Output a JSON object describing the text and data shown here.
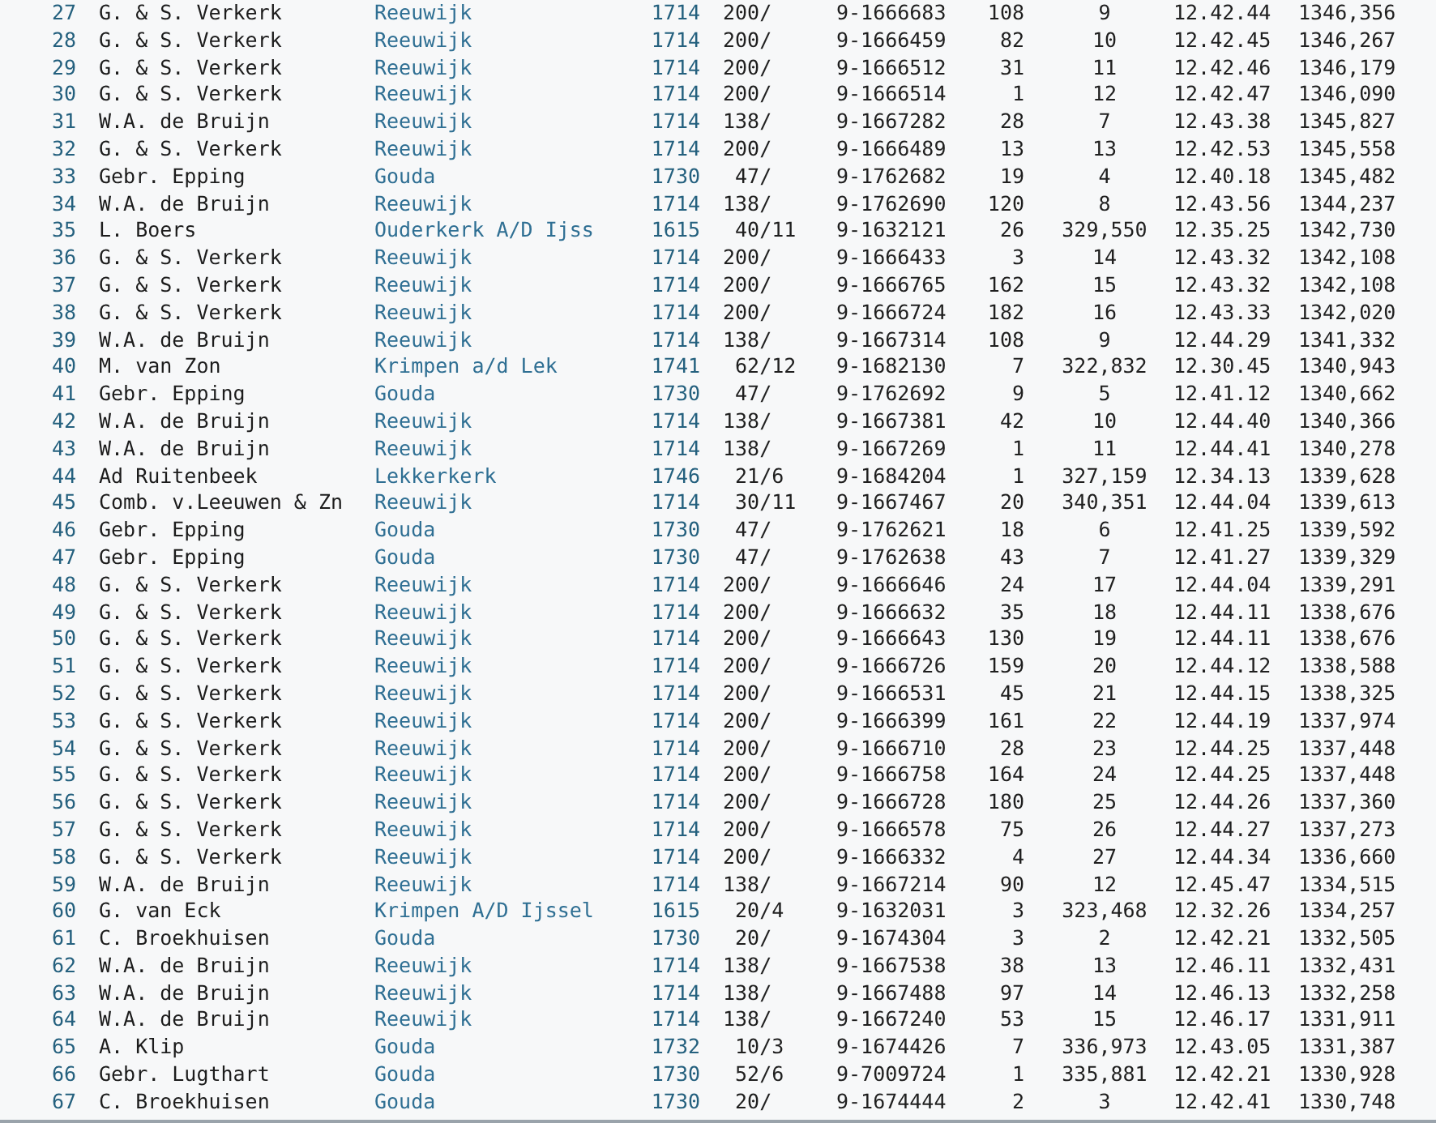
{
  "table": {
    "rows": [
      [
        "27",
        "G. & S. Verkerk",
        "Reeuwijk",
        "1714",
        "200/",
        "9-1666683",
        "108",
        "9",
        "12.42.44",
        "1346,356"
      ],
      [
        "28",
        "G. & S. Verkerk",
        "Reeuwijk",
        "1714",
        "200/",
        "9-1666459",
        "82",
        "10",
        "12.42.45",
        "1346,267"
      ],
      [
        "29",
        "G. & S. Verkerk",
        "Reeuwijk",
        "1714",
        "200/",
        "9-1666512",
        "31",
        "11",
        "12.42.46",
        "1346,179"
      ],
      [
        "30",
        "G. & S. Verkerk",
        "Reeuwijk",
        "1714",
        "200/",
        "9-1666514",
        "1",
        "12",
        "12.42.47",
        "1346,090"
      ],
      [
        "31",
        "W.A. de Bruijn",
        "Reeuwijk",
        "1714",
        "138/",
        "9-1667282",
        "28",
        "7",
        "12.43.38",
        "1345,827"
      ],
      [
        "32",
        "G. & S. Verkerk",
        "Reeuwijk",
        "1714",
        "200/",
        "9-1666489",
        "13",
        "13",
        "12.42.53",
        "1345,558"
      ],
      [
        "33",
        "Gebr. Epping",
        "Gouda",
        "1730",
        "47/",
        "9-1762682",
        "19",
        "4",
        "12.40.18",
        "1345,482"
      ],
      [
        "34",
        "W.A. de Bruijn",
        "Reeuwijk",
        "1714",
        "138/",
        "9-1762690",
        "120",
        "8",
        "12.43.56",
        "1344,237"
      ],
      [
        "35",
        "L. Boers",
        "Ouderkerk A/D Ijss",
        "1615",
        "40/11",
        "9-1632121",
        "26",
        "329,550",
        "12.35.25",
        "1342,730"
      ],
      [
        "36",
        "G. & S. Verkerk",
        "Reeuwijk",
        "1714",
        "200/",
        "9-1666433",
        "3",
        "14",
        "12.43.32",
        "1342,108"
      ],
      [
        "37",
        "G. & S. Verkerk",
        "Reeuwijk",
        "1714",
        "200/",
        "9-1666765",
        "162",
        "15",
        "12.43.32",
        "1342,108"
      ],
      [
        "38",
        "G. & S. Verkerk",
        "Reeuwijk",
        "1714",
        "200/",
        "9-1666724",
        "182",
        "16",
        "12.43.33",
        "1342,020"
      ],
      [
        "39",
        "W.A. de Bruijn",
        "Reeuwijk",
        "1714",
        "138/",
        "9-1667314",
        "108",
        "9",
        "12.44.29",
        "1341,332"
      ],
      [
        "40",
        "M. van Zon",
        "Krimpen a/d Lek",
        "1741",
        "62/12",
        "9-1682130",
        "7",
        "322,832",
        "12.30.45",
        "1340,943"
      ],
      [
        "41",
        "Gebr. Epping",
        "Gouda",
        "1730",
        "47/",
        "9-1762692",
        "9",
        "5",
        "12.41.12",
        "1340,662"
      ],
      [
        "42",
        "W.A. de Bruijn",
        "Reeuwijk",
        "1714",
        "138/",
        "9-1667381",
        "42",
        "10",
        "12.44.40",
        "1340,366"
      ],
      [
        "43",
        "W.A. de Bruijn",
        "Reeuwijk",
        "1714",
        "138/",
        "9-1667269",
        "1",
        "11",
        "12.44.41",
        "1340,278"
      ],
      [
        "44",
        "Ad Ruitenbeek",
        "Lekkerkerk",
        "1746",
        "21/6",
        "9-1684204",
        "1",
        "327,159",
        "12.34.13",
        "1339,628"
      ],
      [
        "45",
        "Comb. v.Leeuwen & Zn",
        "Reeuwijk",
        "1714",
        "30/11",
        "9-1667467",
        "20",
        "340,351",
        "12.44.04",
        "1339,613"
      ],
      [
        "46",
        "Gebr. Epping",
        "Gouda",
        "1730",
        "47/",
        "9-1762621",
        "18",
        "6",
        "12.41.25",
        "1339,592"
      ],
      [
        "47",
        "Gebr. Epping",
        "Gouda",
        "1730",
        "47/",
        "9-1762638",
        "43",
        "7",
        "12.41.27",
        "1339,329"
      ],
      [
        "48",
        "G. & S. Verkerk",
        "Reeuwijk",
        "1714",
        "200/",
        "9-1666646",
        "24",
        "17",
        "12.44.04",
        "1339,291"
      ],
      [
        "49",
        "G. & S. Verkerk",
        "Reeuwijk",
        "1714",
        "200/",
        "9-1666632",
        "35",
        "18",
        "12.44.11",
        "1338,676"
      ],
      [
        "50",
        "G. & S. Verkerk",
        "Reeuwijk",
        "1714",
        "200/",
        "9-1666643",
        "130",
        "19",
        "12.44.11",
        "1338,676"
      ],
      [
        "51",
        "G. & S. Verkerk",
        "Reeuwijk",
        "1714",
        "200/",
        "9-1666726",
        "159",
        "20",
        "12.44.12",
        "1338,588"
      ],
      [
        "52",
        "G. & S. Verkerk",
        "Reeuwijk",
        "1714",
        "200/",
        "9-1666531",
        "45",
        "21",
        "12.44.15",
        "1338,325"
      ],
      [
        "53",
        "G. & S. Verkerk",
        "Reeuwijk",
        "1714",
        "200/",
        "9-1666399",
        "161",
        "22",
        "12.44.19",
        "1337,974"
      ],
      [
        "54",
        "G. & S. Verkerk",
        "Reeuwijk",
        "1714",
        "200/",
        "9-1666710",
        "28",
        "23",
        "12.44.25",
        "1337,448"
      ],
      [
        "55",
        "G. & S. Verkerk",
        "Reeuwijk",
        "1714",
        "200/",
        "9-1666758",
        "164",
        "24",
        "12.44.25",
        "1337,448"
      ],
      [
        "56",
        "G. & S. Verkerk",
        "Reeuwijk",
        "1714",
        "200/",
        "9-1666728",
        "180",
        "25",
        "12.44.26",
        "1337,360"
      ],
      [
        "57",
        "G. & S. Verkerk",
        "Reeuwijk",
        "1714",
        "200/",
        "9-1666578",
        "75",
        "26",
        "12.44.27",
        "1337,273"
      ],
      [
        "58",
        "G. & S. Verkerk",
        "Reeuwijk",
        "1714",
        "200/",
        "9-1666332",
        "4",
        "27",
        "12.44.34",
        "1336,660"
      ],
      [
        "59",
        "W.A. de Bruijn",
        "Reeuwijk",
        "1714",
        "138/",
        "9-1667214",
        "90",
        "12",
        "12.45.47",
        "1334,515"
      ],
      [
        "60",
        "G. van Eck",
        "Krimpen A/D Ijssel",
        "1615",
        "20/4",
        "9-1632031",
        "3",
        "323,468",
        "12.32.26",
        "1334,257"
      ],
      [
        "61",
        "C. Broekhuisen",
        "Gouda",
        "1730",
        "20/",
        "9-1674304",
        "3",
        "2",
        "12.42.21",
        "1332,505"
      ],
      [
        "62",
        "W.A. de Bruijn",
        "Reeuwijk",
        "1714",
        "138/",
        "9-1667538",
        "38",
        "13",
        "12.46.11",
        "1332,431"
      ],
      [
        "63",
        "W.A. de Bruijn",
        "Reeuwijk",
        "1714",
        "138/",
        "9-1667488",
        "97",
        "14",
        "12.46.13",
        "1332,258"
      ],
      [
        "64",
        "W.A. de Bruijn",
        "Reeuwijk",
        "1714",
        "138/",
        "9-1667240",
        "53",
        "15",
        "12.46.17",
        "1331,911"
      ],
      [
        "65",
        "A. Klip",
        "Gouda",
        "1732",
        "10/3",
        "9-1674426",
        "7",
        "336,973",
        "12.43.05",
        "1331,387"
      ],
      [
        "66",
        "Gebr. Lugthart",
        "Gouda",
        "1730",
        "52/6",
        "9-7009724",
        "1",
        "335,881",
        "12.42.21",
        "1330,928"
      ],
      [
        "67",
        "C. Broekhuisen",
        "Gouda",
        "1730",
        "20/",
        "9-1674444",
        "2",
        "3",
        "12.42.41",
        "1330,748"
      ]
    ]
  }
}
